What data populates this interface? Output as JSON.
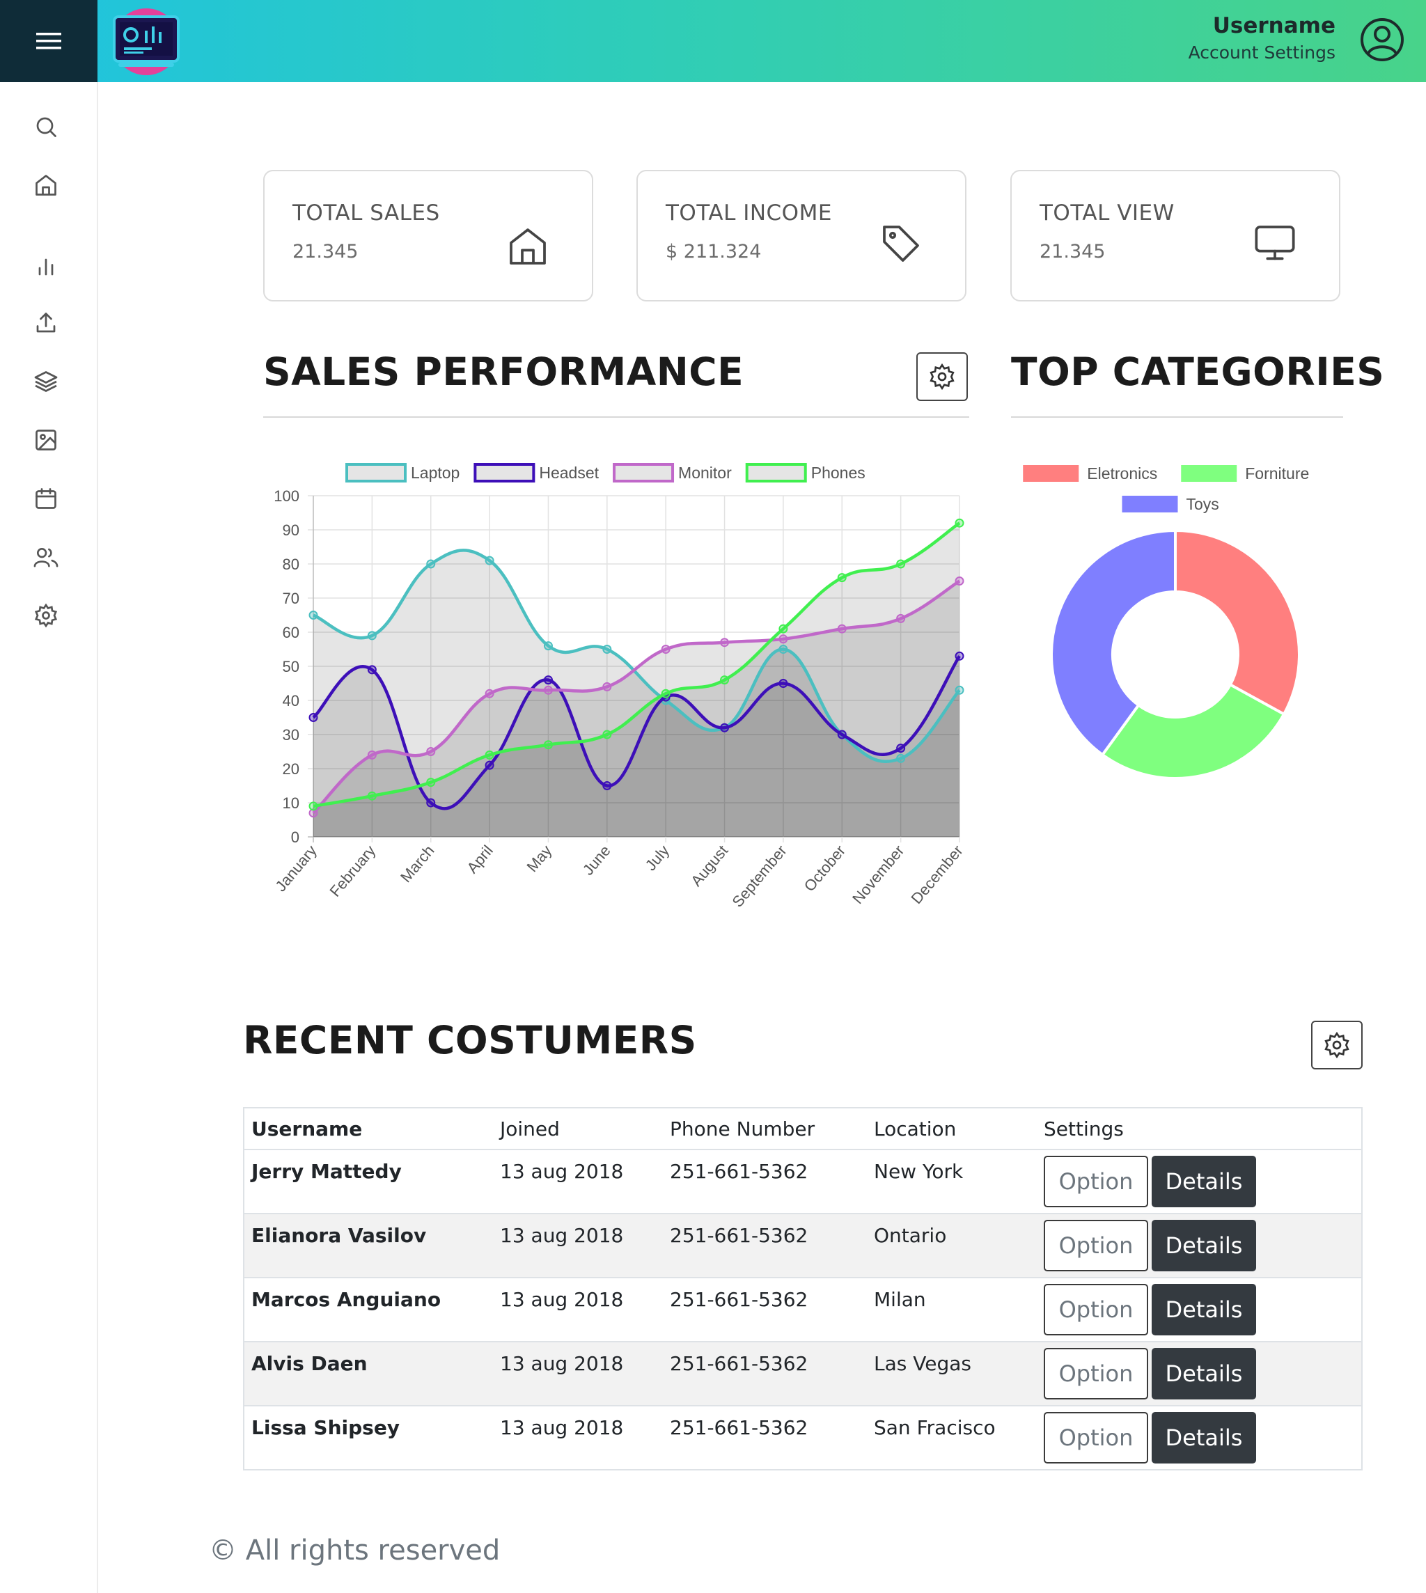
{
  "header": {
    "username": "Username",
    "account_settings": "Account Settings"
  },
  "sidebar": {
    "icons": [
      "search-icon",
      "home-icon",
      "bar-chart-icon",
      "upload-icon",
      "layers-icon",
      "image-icon",
      "calendar-icon",
      "users-icon",
      "settings-icon"
    ]
  },
  "cards": [
    {
      "title": "TOTAL SALES",
      "value": "21.345",
      "icon": "home-icon"
    },
    {
      "title": "TOTAL INCOME",
      "value": "$ 211.324",
      "icon": "tag-icon"
    },
    {
      "title": "TOTAL VIEW",
      "value": "21.345",
      "icon": "monitor-icon"
    }
  ],
  "sales": {
    "title": "SALES PERFORMANCE"
  },
  "categories": {
    "title": "TOP CATEGORIES"
  },
  "customers": {
    "title": "RECENT COSTUMERS",
    "headers": [
      "Username",
      "Joined",
      "Phone Number",
      "Location",
      "Settings"
    ],
    "option_label": "Option",
    "details_label": "Details",
    "rows": [
      {
        "name": "Jerry Mattedy",
        "joined": "13 aug 2018",
        "phone": "251-661-5362",
        "location": "New York"
      },
      {
        "name": "Elianora Vasilov",
        "joined": "13 aug 2018",
        "phone": "251-661-5362",
        "location": "Ontario"
      },
      {
        "name": "Marcos Anguiano",
        "joined": "13 aug 2018",
        "phone": "251-661-5362",
        "location": "Milan"
      },
      {
        "name": "Alvis Daen",
        "joined": "13 aug 2018",
        "phone": "251-661-5362",
        "location": "Las Vegas"
      },
      {
        "name": "Lissa Shipsey",
        "joined": "13 aug 2018",
        "phone": "251-661-5362",
        "location": "San Fracisco"
      }
    ]
  },
  "footer": {
    "text": "© All rights reserved"
  },
  "chart_data": [
    {
      "type": "line",
      "categories": [
        "January",
        "February",
        "March",
        "April",
        "May",
        "June",
        "July",
        "August",
        "September",
        "October",
        "November",
        "December"
      ],
      "ylim": [
        0,
        100
      ],
      "yticks": [
        0,
        10,
        20,
        30,
        40,
        50,
        60,
        70,
        80,
        90,
        100
      ],
      "grid": true,
      "legend": "top",
      "series": [
        {
          "name": "Laptop",
          "color": "#4bbfc0",
          "values": [
            65,
            59,
            80,
            81,
            56,
            55,
            40,
            32,
            55,
            30,
            23,
            43
          ]
        },
        {
          "name": "Headset",
          "color": "#3d0fb8",
          "values": [
            35,
            49,
            10,
            21,
            46,
            15,
            41,
            32,
            45,
            30,
            26,
            53
          ]
        },
        {
          "name": "Monitor",
          "color": "#c068c9",
          "values": [
            7,
            24,
            25,
            42,
            43,
            44,
            55,
            57,
            58,
            61,
            64,
            75
          ]
        },
        {
          "name": "Phones",
          "color": "#40ef4f",
          "values": [
            9,
            12,
            16,
            24,
            27,
            30,
            42,
            46,
            61,
            76,
            80,
            92
          ]
        }
      ]
    },
    {
      "type": "pie",
      "legend": "top",
      "labels": [
        "Eletronics",
        "Forniture",
        "Toys"
      ],
      "colors": [
        "#ff7f7f",
        "#7fff7f",
        "#7f7fff"
      ],
      "values": [
        33,
        27,
        40
      ]
    }
  ]
}
